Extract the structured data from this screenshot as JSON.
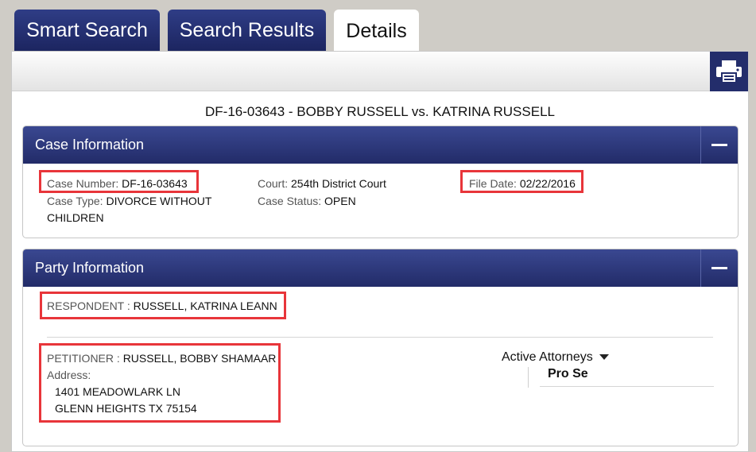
{
  "tabs": [
    {
      "label": "Smart Search"
    },
    {
      "label": "Search Results"
    },
    {
      "label": "Details"
    }
  ],
  "case_title": "DF-16-03643 - BOBBY RUSSELL vs. KATRINA RUSSELL",
  "case_information": {
    "header": "Case Information",
    "case_number_label": "Case Number:",
    "case_number": "DF-16-03643",
    "case_type_label": "Case Type:",
    "case_type_line1": "DIVORCE WITHOUT",
    "case_type_line2": "CHILDREN",
    "court_label": "Court:",
    "court": "254th District Court",
    "case_status_label": "Case Status:",
    "case_status": "OPEN",
    "file_date_label": "File Date:",
    "file_date": "02/22/2016"
  },
  "party_information": {
    "header": "Party Information",
    "respondent_label": "RESPONDENT :",
    "respondent_name": "RUSSELL, KATRINA LEANN",
    "petitioner_label": "PETITIONER :",
    "petitioner_name": "RUSSELL, BOBBY SHAMAAR",
    "address_label": "Address:",
    "address_line1": "1401 MEADOWLARK LN",
    "address_line2": "GLENN HEIGHTS TX 75154",
    "active_attorneys_label": "Active Attorneys",
    "attorney": "Pro Se"
  },
  "colors": {
    "header_navy": "#232d6b",
    "highlight_red": "#e8353a"
  },
  "icons": {
    "print": "print-icon",
    "collapse": "minus-icon",
    "dropdown": "caret-down-icon"
  }
}
